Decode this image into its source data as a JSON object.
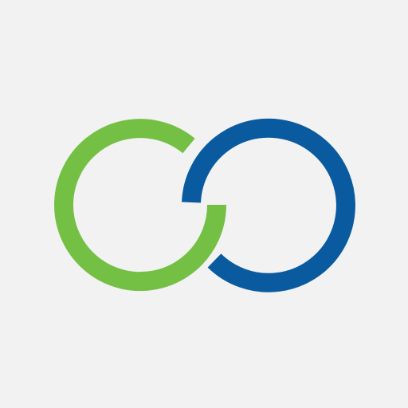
{
  "logo": {
    "icon": "interlocking-rings-logo",
    "colors": {
      "background": "#f2f2f2",
      "left_ring": "#74c044",
      "right_ring": "#0a5a9f"
    }
  }
}
